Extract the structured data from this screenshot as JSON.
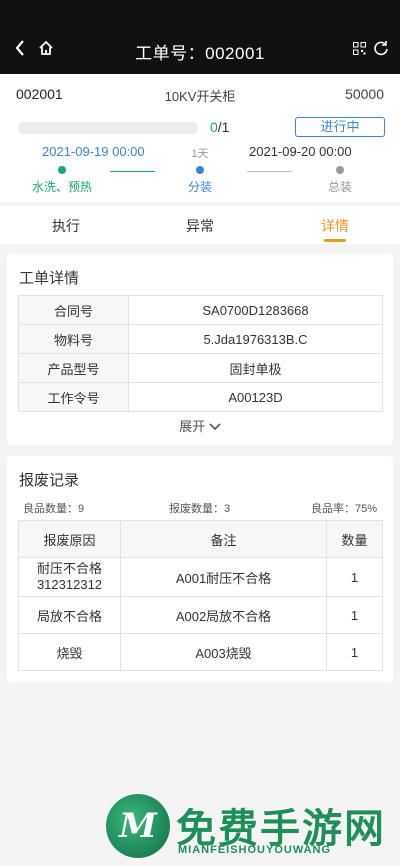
{
  "header": {
    "title": "工单号：002001",
    "back_icon": "chevron-left-icon",
    "home_icon": "home-icon",
    "qr_icon": "qr-code-icon",
    "refresh_icon": "refresh-icon"
  },
  "order": {
    "code": "002001",
    "product_type": "10KV开关柜",
    "quantity": "50000",
    "progress_done": "0",
    "progress_total": "/1",
    "progress_fraction": 0,
    "status": "进行中",
    "start_time": "2021-09-19 00:00",
    "duration": "1天",
    "end_time": "2021-09-20 00:00",
    "steps": [
      {
        "label": "水洗、预热",
        "color": "#19a974"
      },
      {
        "label": "分装",
        "color": "#3b86d8"
      },
      {
        "label": "总装",
        "color": "#999999"
      }
    ]
  },
  "tabs": [
    {
      "label": "执行"
    },
    {
      "label": "异常"
    },
    {
      "label": "详情"
    }
  ],
  "detail": {
    "title": "工单详情",
    "rows": [
      {
        "key": "合同号",
        "value": "SA0700D1283668"
      },
      {
        "key": "物料号",
        "value": "5.Jda1976313B.C"
      },
      {
        "key": "产品型号",
        "value": "固封单极"
      },
      {
        "key": "工作令号",
        "value": "A00123D"
      }
    ],
    "expand_label": "展开",
    "expand_icon": "chevron-down-icon"
  },
  "scrap": {
    "title": "报废记录",
    "good_qty": "良品数量：9",
    "scrap_qty": "报废数量：3",
    "yield": "良品率：75%",
    "columns": [
      "报废原因",
      "备注",
      "数量"
    ],
    "rows": [
      {
        "reason": "耐压不合格\n312312312",
        "note": "A001耐压不合格",
        "count": "1"
      },
      {
        "reason": "局放不合格",
        "note": "A002局放不合格",
        "count": "1"
      },
      {
        "reason": "烧毁",
        "note": "A003烧毁",
        "count": "1"
      }
    ]
  },
  "watermark": {
    "logo_letter": "M",
    "text": "免费手游网",
    "sub": "MIANFEISHOUYOUWANG"
  },
  "colors": {
    "accent_orange": "#e59a22",
    "accent_blue": "#3b86d8",
    "accent_green": "#19a974",
    "header_bg": "#111111"
  }
}
